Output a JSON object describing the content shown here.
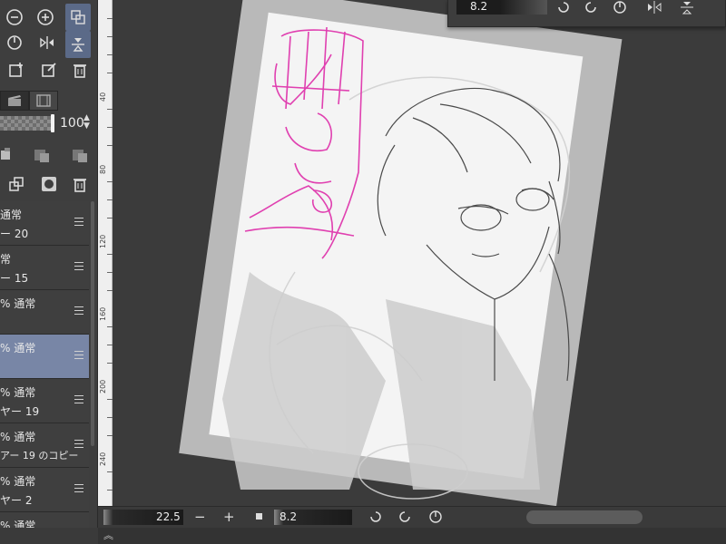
{
  "floating_panel": {
    "brush_size": "8.2"
  },
  "left_panel": {
    "opacity_value": "100",
    "layers": [
      {
        "mode": "通常",
        "name": "ー 20",
        "selected": false
      },
      {
        "mode": "常",
        "name": "ー 15",
        "selected": false
      },
      {
        "mode": "% 通常",
        "name": "",
        "selected": false
      },
      {
        "mode": "% 通常",
        "name": "",
        "selected": true
      },
      {
        "mode": "% 通常",
        "name": "ヤー 19",
        "selected": false
      },
      {
        "mode": "% 通常",
        "name": "アー 19 のコピー",
        "selected": false
      },
      {
        "mode": "% 通常",
        "name": "ヤー 2",
        "selected": false
      },
      {
        "mode": "% 通常",
        "name": "",
        "selected": false
      }
    ]
  },
  "ruler": {
    "labels": [
      "40",
      "80",
      "120",
      "160",
      "200",
      "240"
    ]
  },
  "bottom_bar": {
    "zoom_value": "22.5",
    "zoom_minus": "−",
    "zoom_plus": "+",
    "brush_size_value": "8.2"
  },
  "colors": {
    "accent": "#7886a6",
    "sketch_pink": "#e040b0",
    "canvas_bg": "#3b3b3b"
  }
}
